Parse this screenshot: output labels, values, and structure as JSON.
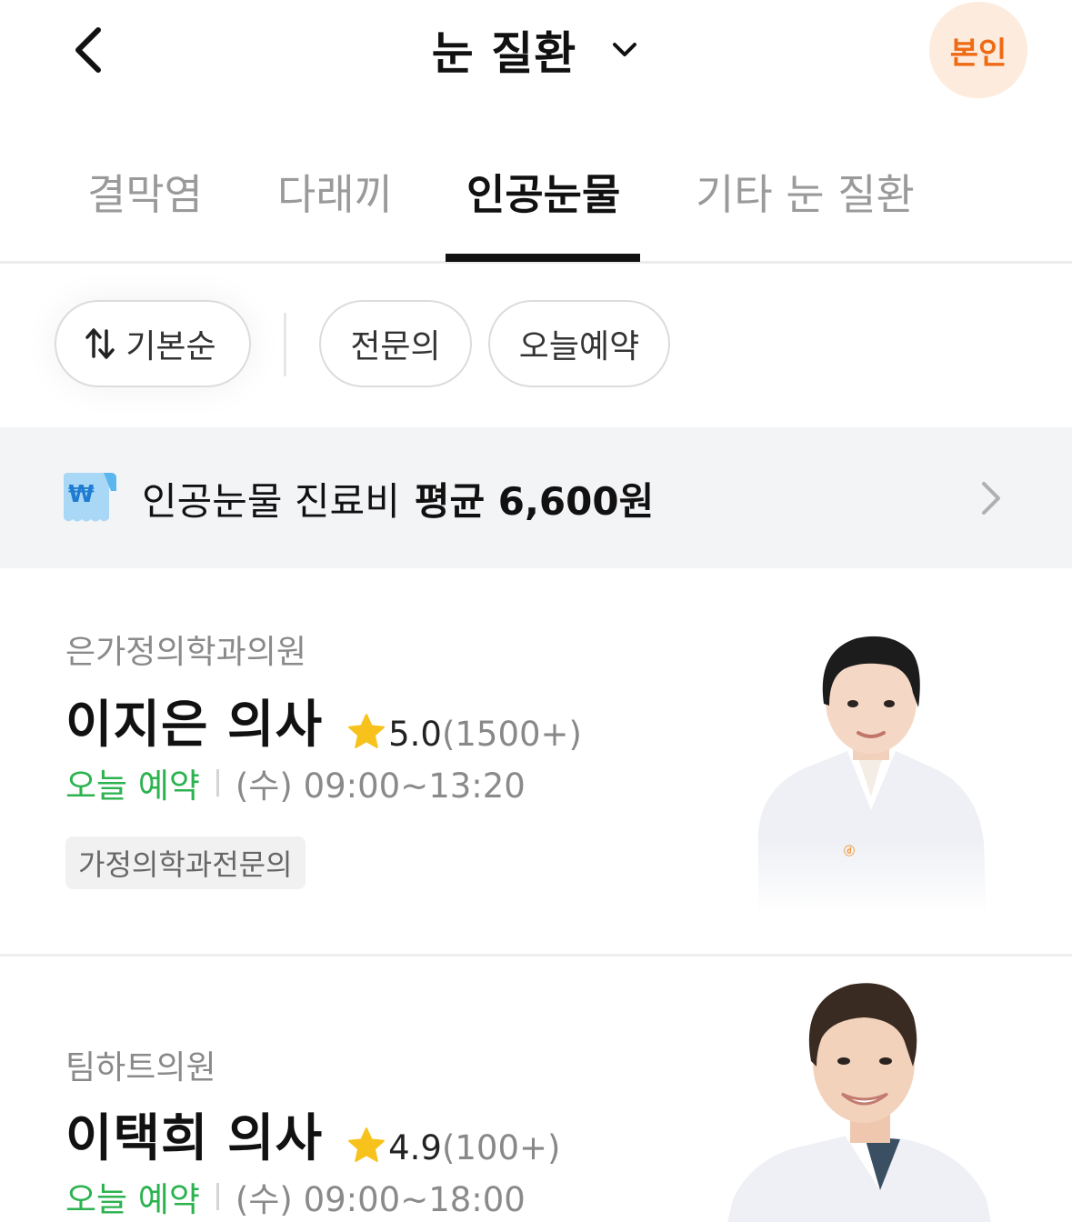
{
  "header": {
    "title": "눈 질환",
    "profile_label": "본인"
  },
  "tabs": [
    {
      "label": "결막염",
      "active": false
    },
    {
      "label": "다래끼",
      "active": false
    },
    {
      "label": "인공눈물",
      "active": true
    },
    {
      "label": "기타 눈 질환",
      "active": false
    }
  ],
  "filters": {
    "sort_label": "기본순",
    "chips": [
      "전문의",
      "오늘예약"
    ]
  },
  "cost_banner": {
    "label": "인공눈물 진료비",
    "value": "평균 6,600원"
  },
  "doctors": [
    {
      "clinic": "은가정의학과의원",
      "name": "이지은 의사",
      "rating": "5.0",
      "review_count": "(1500+)",
      "availability": "오늘 예약",
      "hours": "(수) 09:00~13:20",
      "tag": "가정의학과전문의"
    },
    {
      "clinic": "팀하트의원",
      "name": "이택희 의사",
      "rating": "4.9",
      "review_count": "(100+)",
      "availability": "오늘 예약",
      "hours": "(수) 09:00~18:00"
    }
  ],
  "colors": {
    "accent_orange": "#ee6a14",
    "profile_bg": "#fdecde",
    "available_green": "#2cb24f",
    "star_yellow": "#f8c21c",
    "banner_bg": "#f3f4f6"
  }
}
